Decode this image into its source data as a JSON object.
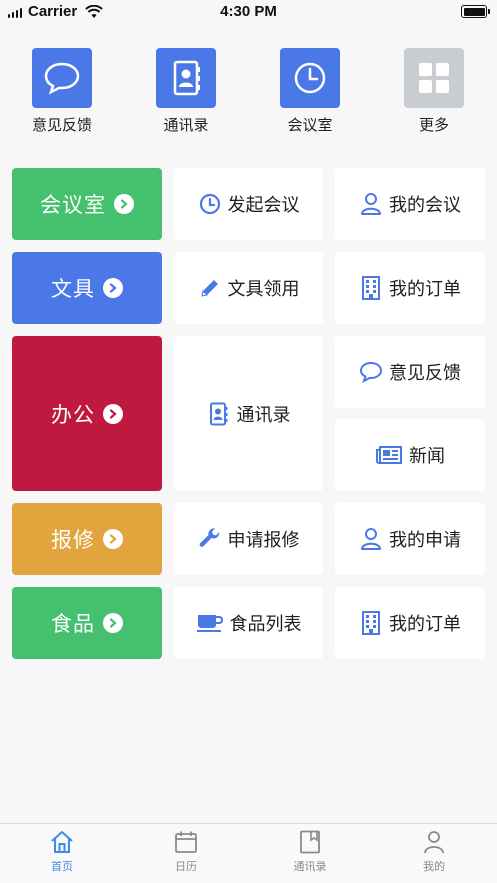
{
  "status_bar": {
    "carrier": "Carrier",
    "time": "4:30 PM"
  },
  "quick_links": [
    {
      "label": "意见反馈",
      "icon": "chat-bubble-icon",
      "color": "#4a78e6"
    },
    {
      "label": "通讯录",
      "icon": "contacts-book-icon",
      "color": "#4a78e6"
    },
    {
      "label": "会议室",
      "icon": "clock-icon",
      "color": "#4a78e6"
    },
    {
      "label": "更多",
      "icon": "grid-icon",
      "color": "#c9ccd1"
    }
  ],
  "sections": {
    "meeting": {
      "label": "会议室",
      "color": "#45c06f",
      "actions": [
        "发起会议",
        "我的会议"
      ]
    },
    "stationery": {
      "label": "文具",
      "color": "#4a78e6",
      "actions": [
        "文具领用",
        "我的订单"
      ]
    },
    "office": {
      "label": "办公",
      "color": "#c0193f",
      "actions": [
        "通讯录",
        "意见反馈",
        "新闻"
      ]
    },
    "repair": {
      "label": "报修",
      "color": "#e2a43c",
      "actions": [
        "申请报修",
        "我的申请"
      ]
    },
    "food": {
      "label": "食品",
      "color": "#45c06f",
      "actions": [
        "食品列表",
        "我的订单"
      ]
    }
  },
  "accent": "#4a78e6",
  "tabbar": {
    "tabs": [
      {
        "label": "首页",
        "icon": "home-icon",
        "active": true
      },
      {
        "label": "日历",
        "icon": "calendar-icon",
        "active": false
      },
      {
        "label": "通讯录",
        "icon": "address-book-icon",
        "active": false
      },
      {
        "label": "我的",
        "icon": "user-icon",
        "active": false
      }
    ]
  }
}
